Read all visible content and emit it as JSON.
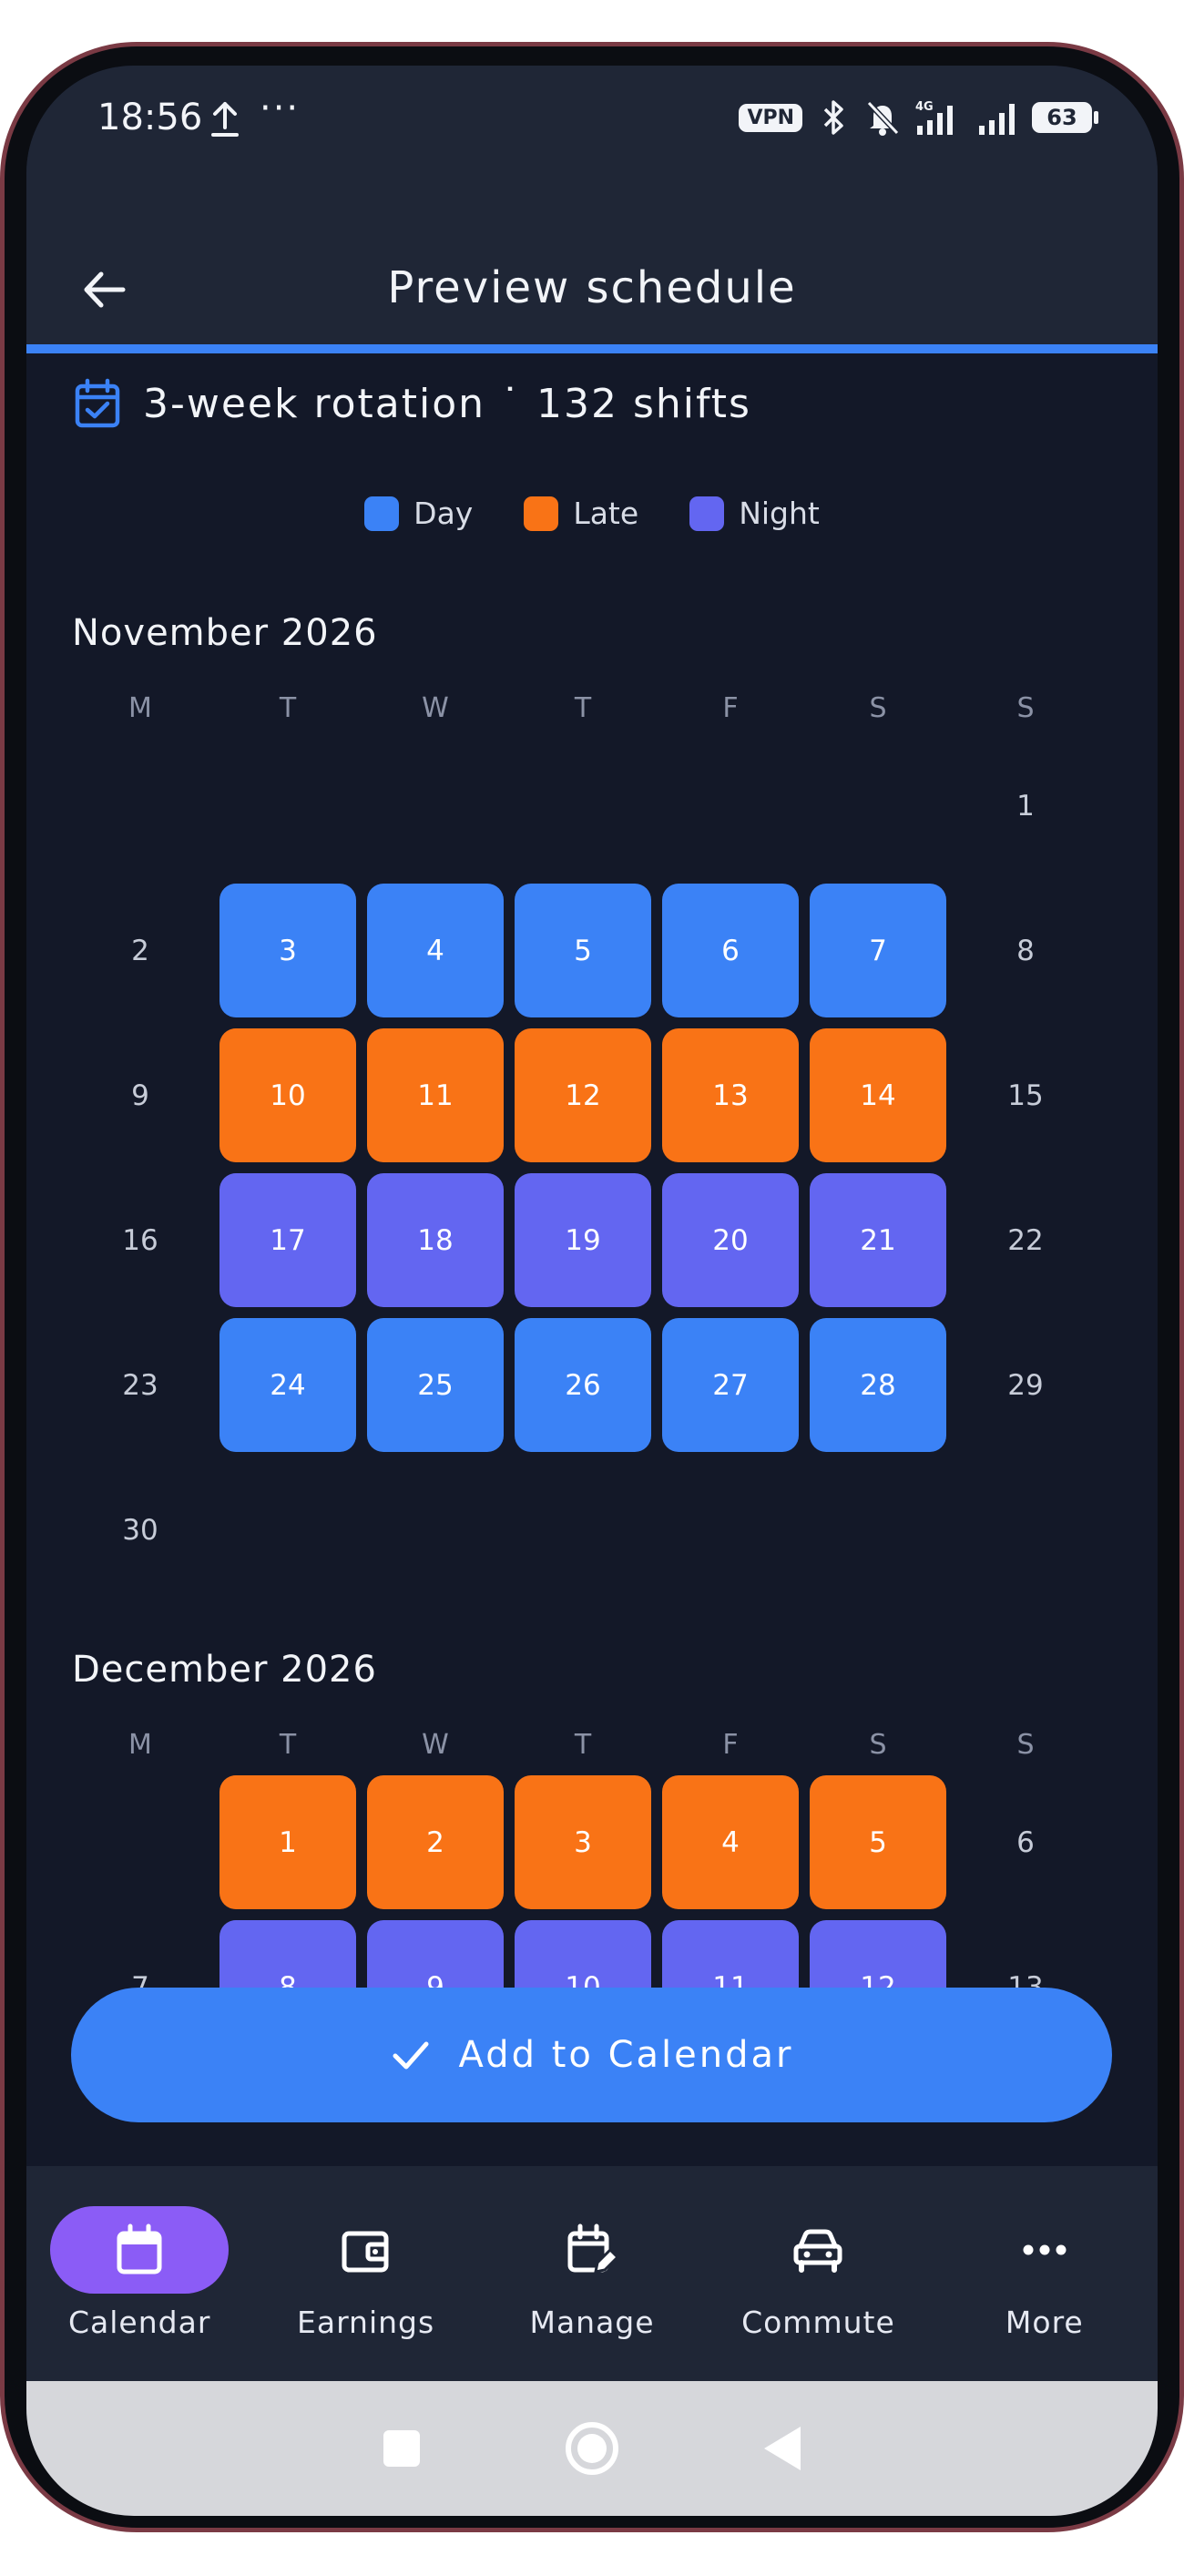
{
  "status_bar": {
    "time": "18:56",
    "overflow": "···",
    "vpn": "VPN",
    "network": "4G",
    "battery": "63"
  },
  "app_bar": {
    "title": "Preview schedule",
    "back_icon": "arrow-left-icon"
  },
  "summary": {
    "text": "3-week rotation ˙ 132 shifts",
    "icon": "calendar-check-icon"
  },
  "legend": [
    {
      "label": "Day",
      "color": "#3b82f6"
    },
    {
      "label": "Late",
      "color": "#f97316"
    },
    {
      "label": "Night",
      "color": "#6366f1"
    }
  ],
  "shift_colors": {
    "day": "#3b82f6",
    "late": "#f97316",
    "night": "#6366f1"
  },
  "weekdays": [
    "M",
    "T",
    "W",
    "T",
    "F",
    "S",
    "S"
  ],
  "months": [
    {
      "title": "November 2026",
      "first_weekday": 6,
      "days_in_month": 30,
      "shifts": {
        "3": "day",
        "4": "day",
        "5": "day",
        "6": "day",
        "7": "day",
        "10": "late",
        "11": "late",
        "12": "late",
        "13": "late",
        "14": "late",
        "17": "night",
        "18": "night",
        "19": "night",
        "20": "night",
        "21": "night",
        "24": "day",
        "25": "day",
        "26": "day",
        "27": "day",
        "28": "day"
      }
    },
    {
      "title": "December 2026",
      "first_weekday": 1,
      "days_in_month": 13,
      "shifts": {
        "1": "late",
        "2": "late",
        "3": "late",
        "4": "late",
        "5": "late",
        "8": "night",
        "9": "night",
        "10": "night",
        "11": "night",
        "12": "night"
      }
    }
  ],
  "add_button": {
    "label": "Add to Calendar",
    "icon": "check-icon"
  },
  "bottom_nav": [
    {
      "label": "Calendar",
      "icon": "calendar-icon",
      "active": true
    },
    {
      "label": "Earnings",
      "icon": "wallet-icon",
      "active": false
    },
    {
      "label": "Manage",
      "icon": "calendar-edit-icon",
      "active": false
    },
    {
      "label": "Commute",
      "icon": "car-icon",
      "active": false
    },
    {
      "label": "More",
      "icon": "more-horizontal-icon",
      "active": false
    }
  ]
}
